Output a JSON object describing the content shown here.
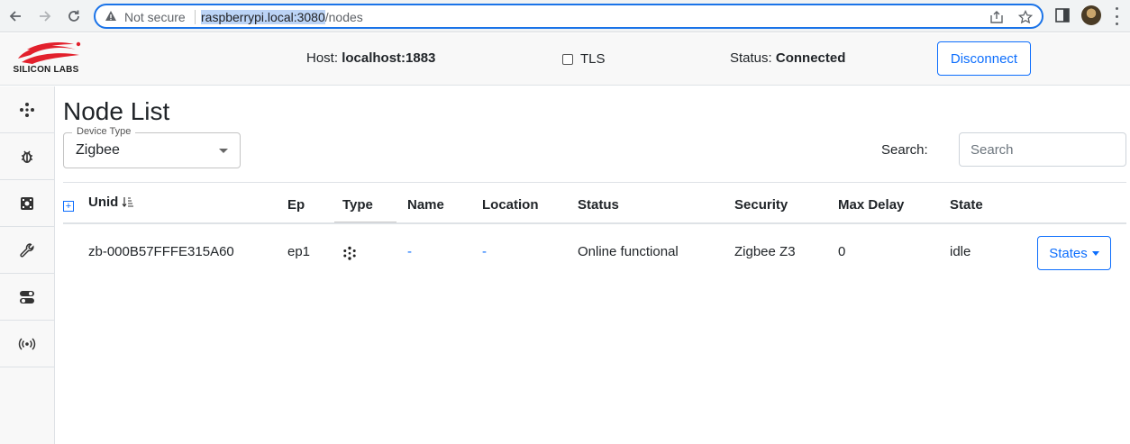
{
  "browser": {
    "security_label": "Not secure",
    "url_selected": "raspberrypi.local:3080",
    "url_rest": "/nodes"
  },
  "header": {
    "logo_text": "SILICON LABS",
    "host_label": "Host:",
    "host_value": "localhost:1883",
    "tls_label": "TLS",
    "status_label": "Status:",
    "status_value": "Connected",
    "disconnect_label": "Disconnect"
  },
  "sidebar": {
    "items": [
      {
        "icon": "network-nodes-icon"
      },
      {
        "icon": "bug-icon"
      },
      {
        "icon": "circuit-icon"
      },
      {
        "icon": "wrench-icon"
      },
      {
        "icon": "toggles-icon"
      },
      {
        "icon": "broadcast-icon"
      }
    ]
  },
  "main": {
    "title": "Node List",
    "device_type_label": "Device Type",
    "device_type_value": "Zigbee",
    "search_label": "Search:",
    "search_placeholder": "Search",
    "columns": [
      "Unid",
      "Ep",
      "Type",
      "Name",
      "Location",
      "Status",
      "Security",
      "Max Delay",
      "State"
    ],
    "rows": [
      {
        "unid": "zb-000B57FFFE315A60",
        "ep": "ep1",
        "type_icon": "network-nodes-icon",
        "name": "-",
        "location": "-",
        "status": "Online functional",
        "security": "Zigbee Z3",
        "max_delay": "0",
        "state": "idle",
        "action_label": "States"
      }
    ]
  },
  "colors": {
    "accent": "#0d6efd",
    "omnibox_border": "#1a73e8",
    "logo_red": "#e2202c"
  }
}
